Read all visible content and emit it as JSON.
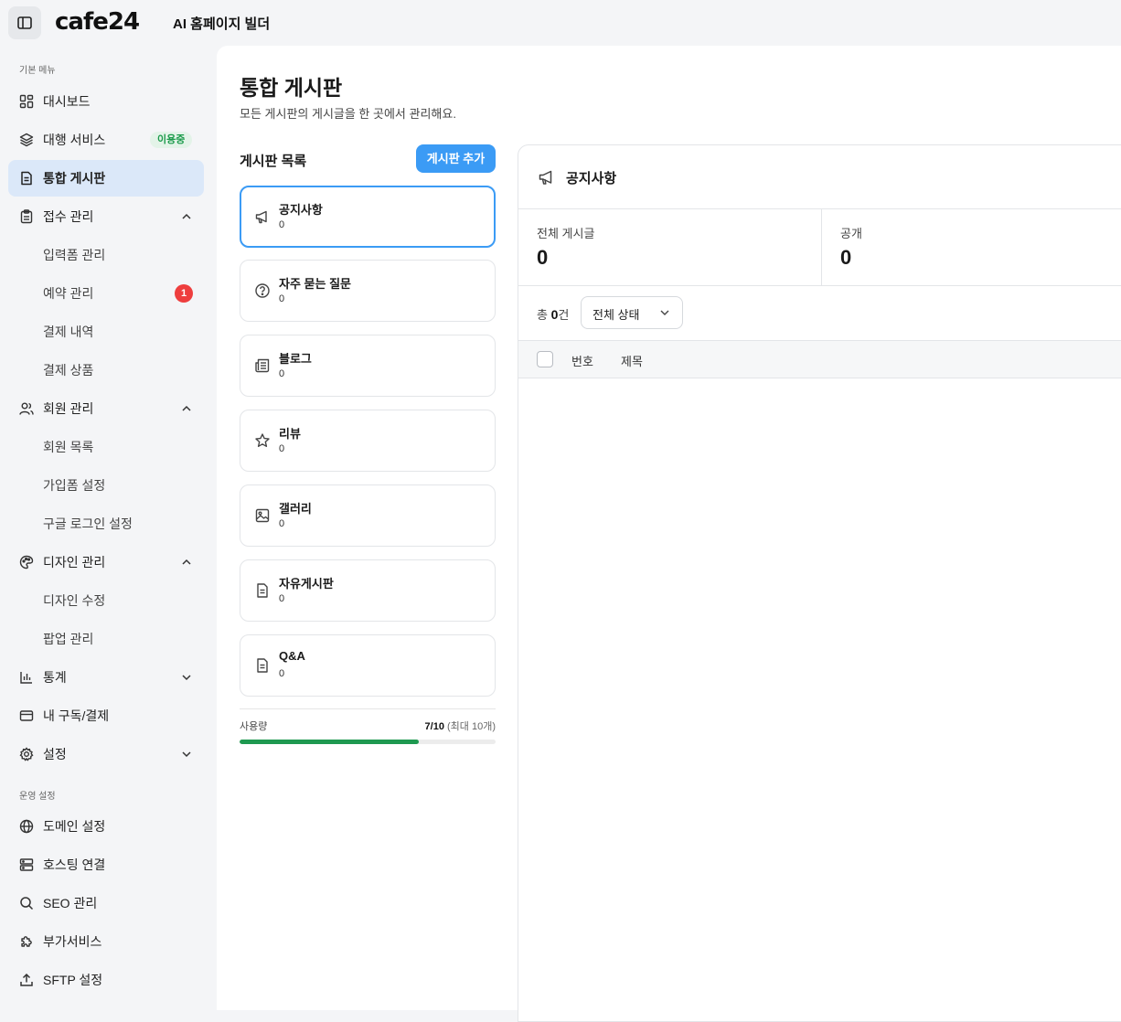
{
  "header": {
    "logo": "cafe24",
    "app_title": "AI 홈페이지 빌더"
  },
  "sidebar": {
    "section_basic": "기본 메뉴",
    "section_ops": "운영 설정",
    "items": {
      "dashboard": "대시보드",
      "agency": "대행 서비스",
      "agency_badge": "이용중",
      "board": "통합 게시판",
      "reception": "접수 관리",
      "form": "입력폼 관리",
      "reservation": "예약 관리",
      "reservation_badge": "1",
      "payment_history": "결제 내역",
      "payment_products": "결제 상품",
      "members": "회원 관리",
      "member_list": "회원 목록",
      "signup_settings": "가입폼 설정",
      "google_login": "구글 로그인 설정",
      "design": "디자인 관리",
      "design_edit": "디자인 수정",
      "popup": "팝업 관리",
      "stats": "통계",
      "subscription": "내 구독/결제",
      "settings": "설정",
      "domain": "도메인 설정",
      "hosting": "호스팅 연결",
      "seo": "SEO 관리",
      "addons": "부가서비스",
      "sftp": "SFTP 설정"
    }
  },
  "main": {
    "title": "통합 게시판",
    "subtitle": "모든 게시판의 게시글을 한 곳에서 관리해요.",
    "list_title": "게시판 목록",
    "add_button": "게시판 추가",
    "boards": [
      {
        "name": "공지사항",
        "count": "0",
        "icon": "megaphone-icon"
      },
      {
        "name": "자주 묻는 질문",
        "count": "0",
        "icon": "question-circle-icon"
      },
      {
        "name": "블로그",
        "count": "0",
        "icon": "newspaper-icon"
      },
      {
        "name": "리뷰",
        "count": "0",
        "icon": "star-icon"
      },
      {
        "name": "갤러리",
        "count": "0",
        "icon": "image-icon"
      },
      {
        "name": "자유게시판",
        "count": "0",
        "icon": "document-icon"
      },
      {
        "name": "Q&A",
        "count": "0",
        "icon": "document-icon"
      }
    ],
    "usage": {
      "label": "사용량",
      "value": "7/10",
      "max_note": "(최대 10개)",
      "fraction": 0.7
    }
  },
  "detail": {
    "title": "공지사항",
    "stats": [
      {
        "label": "전체 게시글",
        "value": "0"
      },
      {
        "label": "공개",
        "value": "0"
      }
    ],
    "total_prefix": "총",
    "total_count": "0",
    "total_suffix": "건",
    "status_select": "전체 상태",
    "columns": [
      "번호",
      "제목"
    ]
  },
  "colors": {
    "accent": "#3b9bf5",
    "active_bg": "#dbe8f9",
    "badge_green": "#1a9a4a",
    "badge_red": "#ee3e3e",
    "usage_fill": "#1e9950"
  }
}
